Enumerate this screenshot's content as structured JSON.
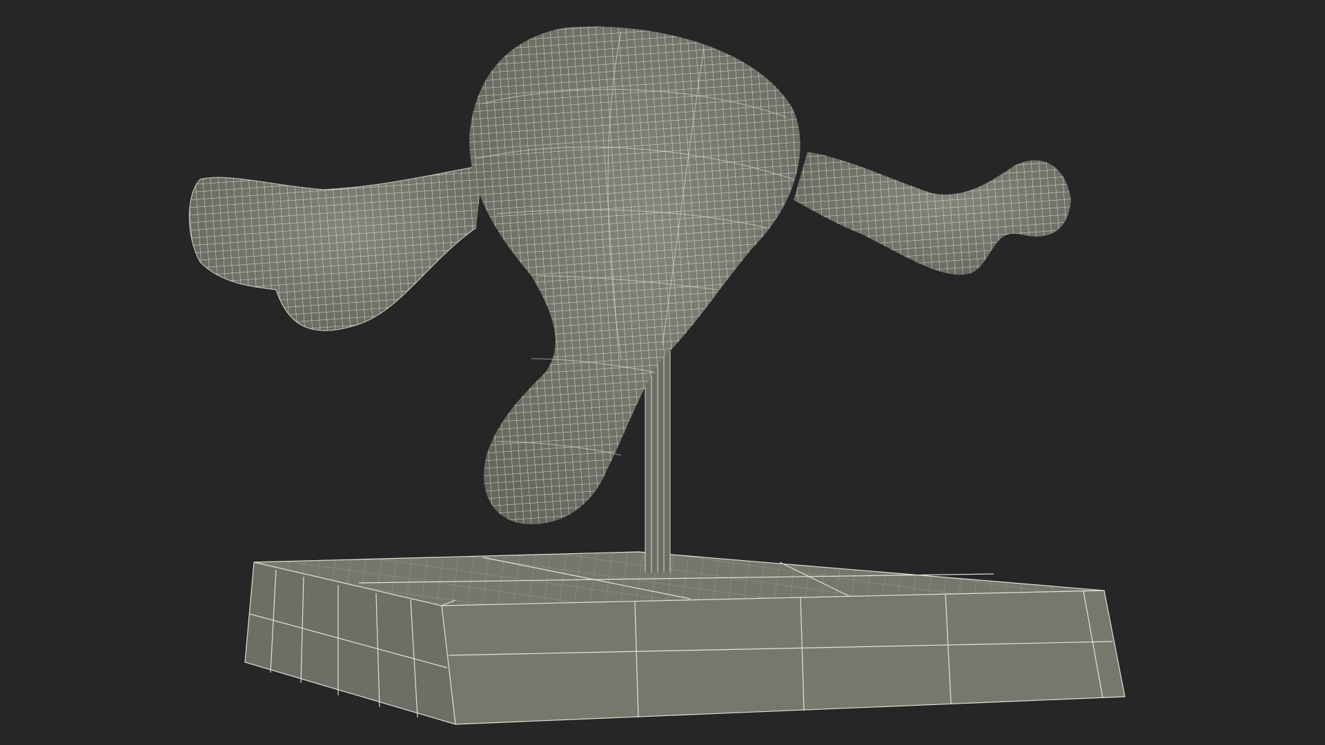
{
  "scene": {
    "background_color": "#262626",
    "surface_color": "#7b7b72",
    "surface_shadow_color": "#5f5f57",
    "wireframe_color": "#f1f1e6",
    "objects": [
      "uterus-model-wireframe",
      "support-rod",
      "display-base"
    ]
  }
}
